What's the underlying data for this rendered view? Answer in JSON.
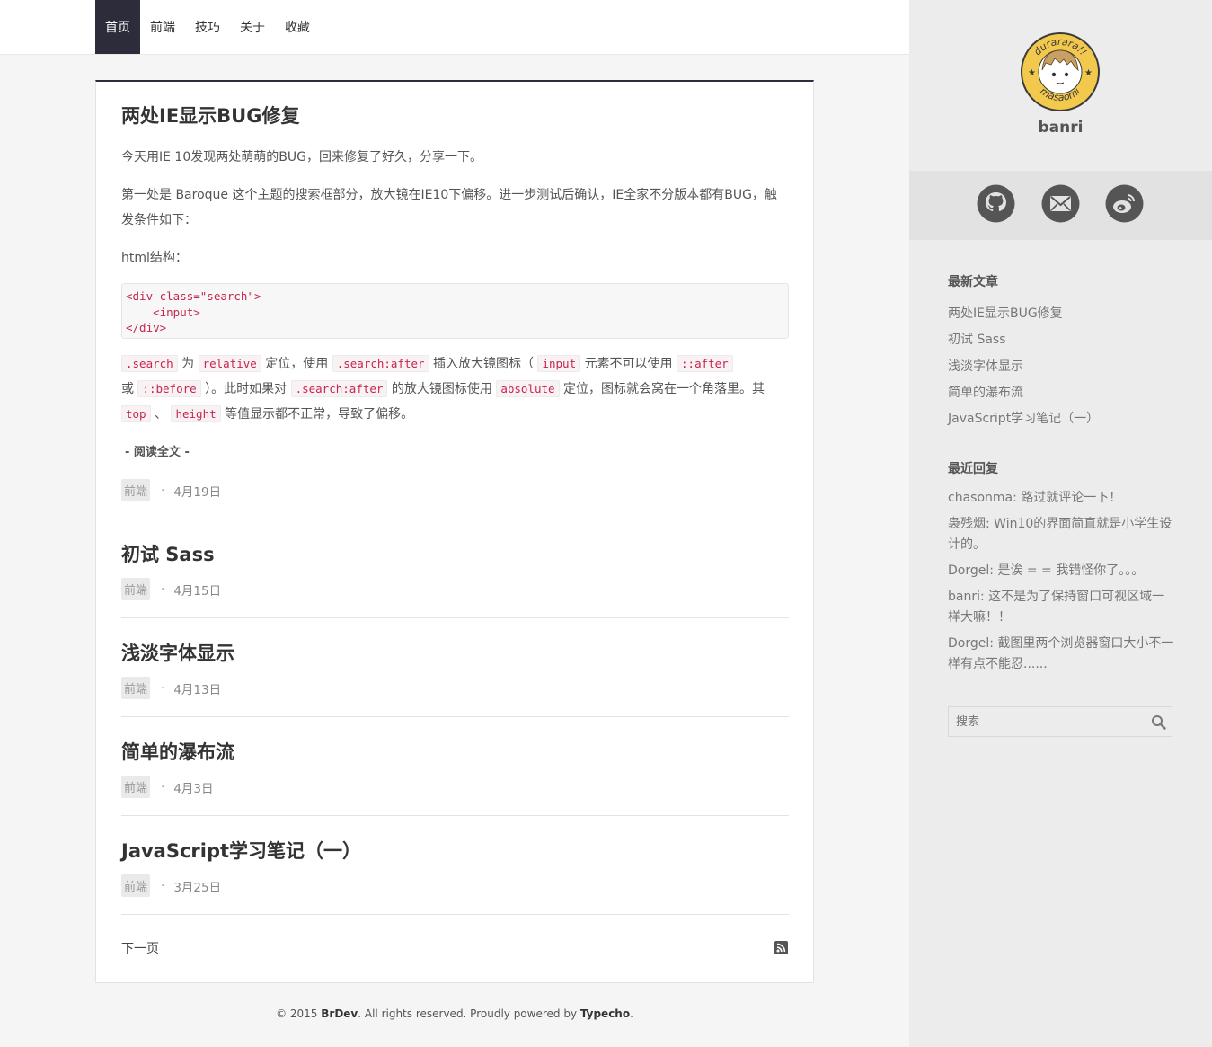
{
  "nav": {
    "items": [
      "首页",
      "前端",
      "技巧",
      "关于",
      "收藏"
    ]
  },
  "featured": {
    "title": "两处IE显示BUG修复",
    "intro": "今天用IE 10发现两处萌萌的BUG，回来修复了好久，分享一下。",
    "para1": "第一处是 Baroque 这个主题的搜索框部分，放大镜在IE10下偏移。进一步测试后确认，IE全家不分版本都有BUG，触发条件如下：",
    "html_label": "html结构：",
    "code": "<div class=\"search\">\n    <input>\n</div>",
    "p2": {
      "c1": ".search",
      "t1": "为",
      "c2": "relative",
      "t2": "定位，使用",
      "c3": ".search:after",
      "t3": "插入放大镜图标（",
      "c4": "input",
      "t4": "元素不可以使用",
      "c5": "::after",
      "t5": "或",
      "c6": "::before",
      "t6": "）。此时如果对",
      "c7": ".search:after",
      "t7": "的放大镜图标使用",
      "c8": "absolute",
      "t8": "定位，图标就会窝在一个角落里。其",
      "c9": "top",
      "t9": "、",
      "c10": "height",
      "t10": "等值显示都不正常，导致了偏移。"
    },
    "readmore": "- 阅读全文 -",
    "category": "前端",
    "date": "4月19日"
  },
  "posts": [
    {
      "title": "初试 Sass",
      "category": "前端",
      "date": "4月15日"
    },
    {
      "title": "浅淡字体显示",
      "category": "前端",
      "date": "4月13日"
    },
    {
      "title": "简单的瀑布流",
      "category": "前端",
      "date": "4月3日"
    },
    {
      "title": "JavaScript学习笔记（一）",
      "category": "前端",
      "date": "3月25日"
    }
  ],
  "separator": "·",
  "pagination": {
    "next": "下一页"
  },
  "footer": {
    "prefix": "© 2015 ",
    "site": "BrDev",
    "middle": ". All rights reserved. Proudly powered by ",
    "engine": "Typecho",
    "suffix": "."
  },
  "sidebar": {
    "avatar_text_top": "durarara!!",
    "avatar_text_bottom": "masaomi",
    "username": "banri",
    "social_icons": [
      "github-icon",
      "mail-icon",
      "weibo-icon"
    ],
    "recent_posts_title": "最新文章",
    "recent_posts": [
      "两处IE显示BUG修复",
      "初试 Sass",
      "浅淡字体显示",
      "简单的瀑布流",
      "JavaScript学习笔记（一）"
    ],
    "recent_replies_title": "最近回复",
    "recent_replies": [
      "chasonma: 路过就评论一下！",
      "袅残烟: Win10的界面简直就是小学生设计的。",
      "Dorgel: 是诶 = = 我错怪你了。。。",
      "banri: 这不是为了保持窗口可视区域一样大嘛！！",
      "Dorgel: 截图里两个浏览器窗口大小不一样有点不能忍......"
    ],
    "search_placeholder": "搜索"
  },
  "colors": {
    "nav_active": "#2c2c3a",
    "code_text": "#c7254e",
    "sidebar_bg": "#ececec",
    "avatar_gold": "#f2c94c"
  }
}
